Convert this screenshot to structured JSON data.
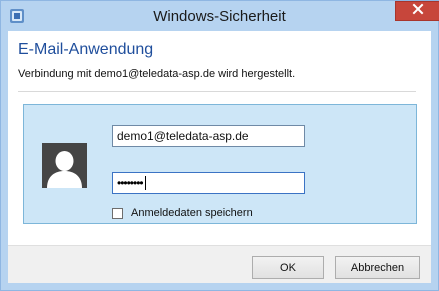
{
  "window": {
    "title": "Windows-Sicherheit",
    "close_icon": "close-icon"
  },
  "dialog": {
    "heading": "E-Mail-Anwendung",
    "subtext": "Verbindung mit demo1@teledata-asp.de wird hergestellt."
  },
  "credentials": {
    "avatar_icon": "user-avatar-icon",
    "username_value": "demo1@teledata-asp.de",
    "password_masked": "••••••••",
    "remember_label": "Anmeldedaten speichern",
    "remember_checked": false
  },
  "buttons": {
    "ok_label": "OK",
    "cancel_label": "Abbrechen"
  },
  "colors": {
    "title_bg": "#b6d3f0",
    "heading": "#1f4e9c",
    "panel_bg": "#cde6f7",
    "close_button": "#c7463b"
  }
}
